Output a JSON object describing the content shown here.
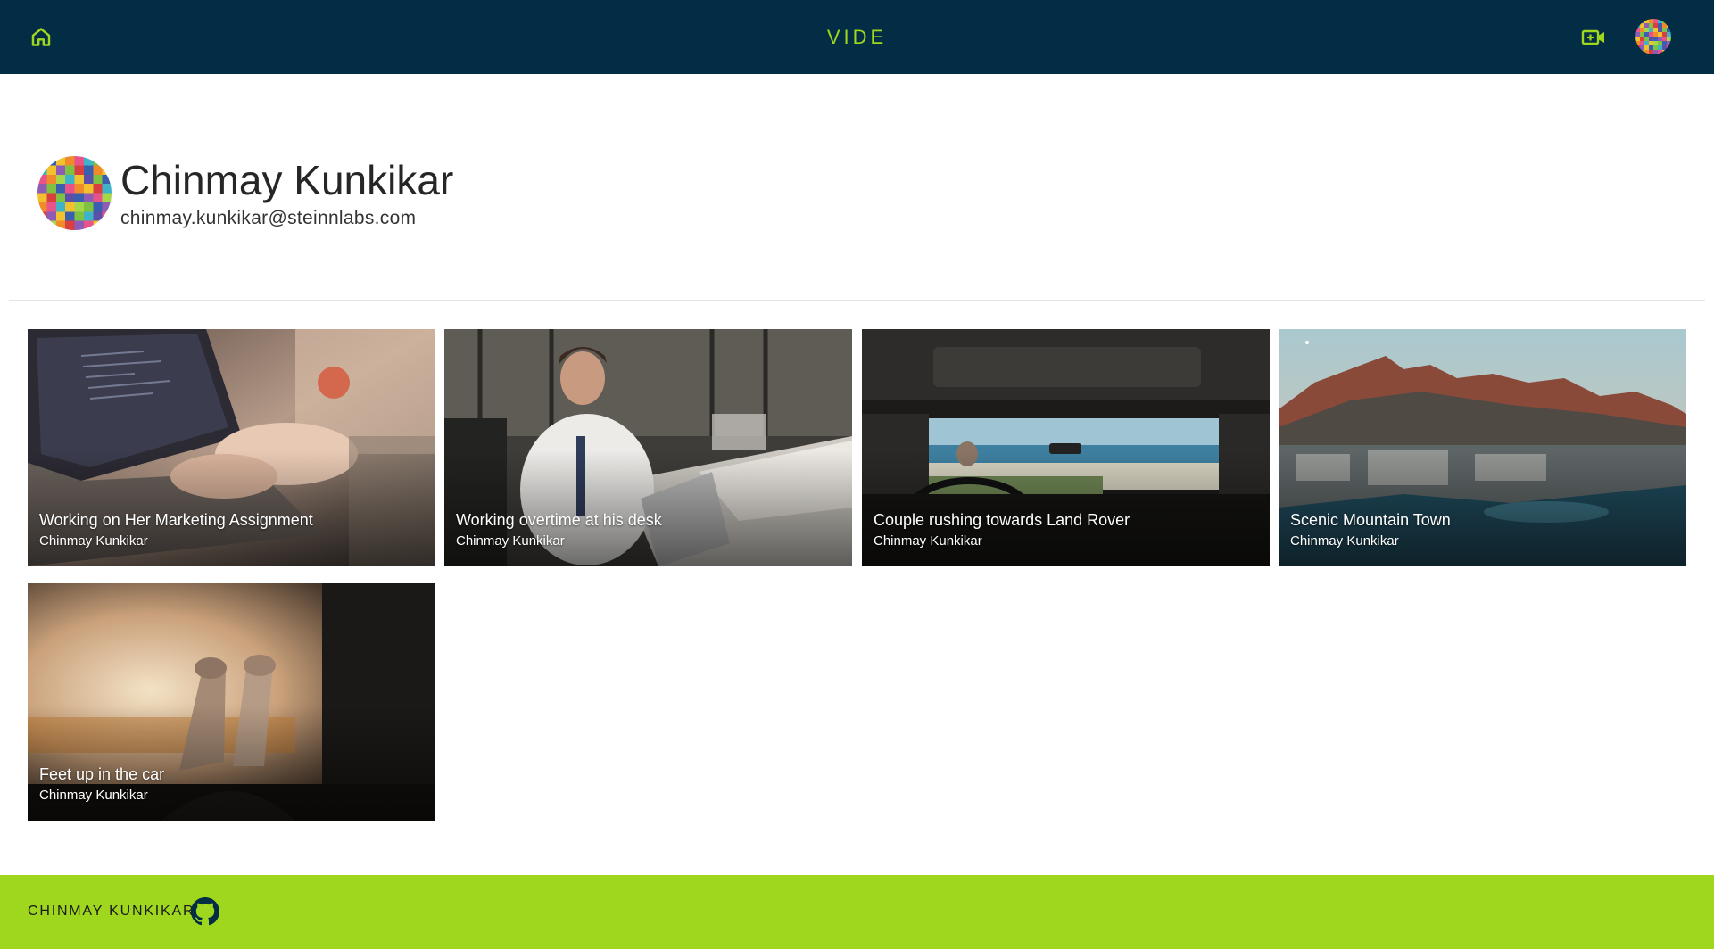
{
  "header": {
    "brand": "VIDE",
    "home_icon": "home-icon",
    "upload_icon": "video-add-icon",
    "avatar_icon": "pixel-avatar-icon"
  },
  "profile": {
    "name": "Chinmay Kunkikar",
    "email": "chinmay.kunkikar@steinnlabs.com"
  },
  "videos": [
    {
      "title": "Working on Her Marketing Assignment",
      "author": "Chinmay Kunkikar"
    },
    {
      "title": "Working overtime at his desk",
      "author": "Chinmay Kunkikar"
    },
    {
      "title": "Couple rushing towards Land Rover",
      "author": "Chinmay Kunkikar"
    },
    {
      "title": "Scenic Mountain Town",
      "author": "Chinmay Kunkikar"
    },
    {
      "title": "Feet up in the car",
      "author": "Chinmay Kunkikar"
    }
  ],
  "footer": {
    "name": "CHINMAY KUNKIKAR",
    "github_icon": "github-icon"
  },
  "colors": {
    "header_bg": "#032d45",
    "accent": "#9fd61e",
    "footer_bg": "#9fd61e"
  }
}
